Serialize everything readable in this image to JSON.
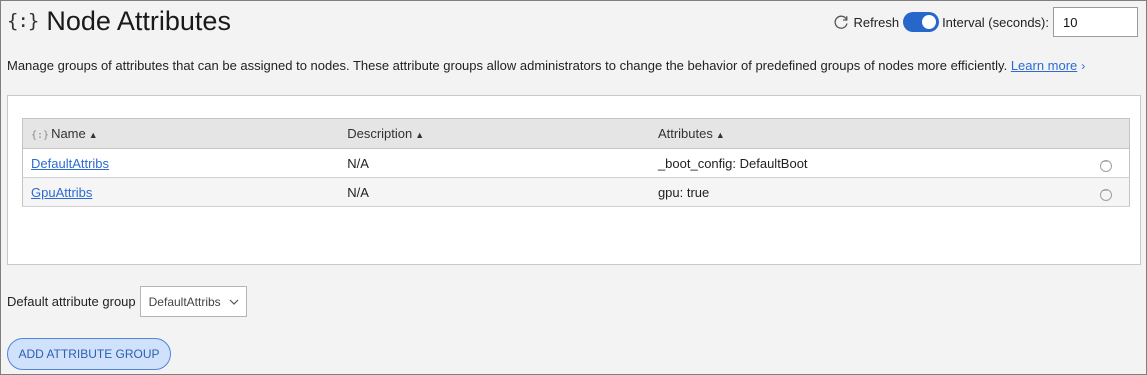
{
  "header": {
    "icon": "{:}",
    "title": "Node Attributes"
  },
  "toolbar": {
    "refresh_label": "Refresh",
    "refresh_enabled": true,
    "interval_label": "Interval (seconds):",
    "interval_value": "10"
  },
  "description": {
    "text": "Manage groups of attributes that can be assigned to nodes. These attribute groups allow administrators to change the behavior of predefined groups of nodes more efficiently.",
    "learn_more": "Learn more"
  },
  "table": {
    "header_icon": "{:}",
    "columns": [
      "Name",
      "Description",
      "Attributes"
    ],
    "sort_indicator": "▲",
    "rows": [
      {
        "name": "DefaultAttribs",
        "description": "N/A",
        "attributes": "_boot_config: DefaultBoot"
      },
      {
        "name": "GpuAttribs",
        "description": "N/A",
        "attributes": "gpu: true"
      }
    ]
  },
  "default_group": {
    "label": "Default attribute group",
    "selected": "DefaultAttribs"
  },
  "add_button": {
    "label": "ADD ATTRIBUTE GROUP"
  },
  "colors": {
    "accent": "#2667c9",
    "link": "#2d6bd3",
    "button_bg": "#cfe1fb"
  }
}
